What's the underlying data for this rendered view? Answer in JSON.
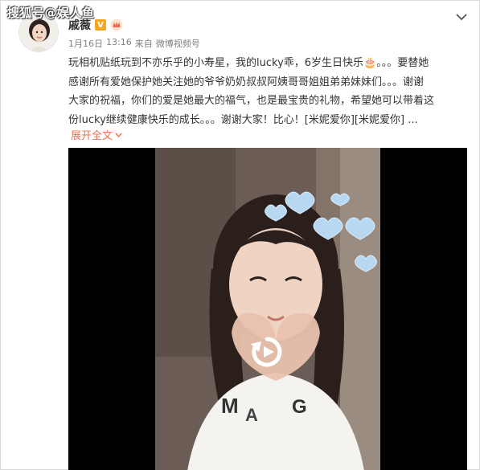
{
  "watermark": "搜狐号@娱人鱼",
  "user": {
    "name": "戚薇",
    "verified_badge": "V"
  },
  "meta": {
    "date": "1月16日",
    "time": "13:16",
    "source_prefix": "来自",
    "source": "微博视频号"
  },
  "post": {
    "line1_a": "玩相机贴纸玩到不亦乐乎的小寿星，我的lucky乖，6岁生日快乐",
    "cake": "🎂",
    "line1_b": "。。。要替她",
    "line2": "感谢所有爱她保护她关注她的爷爷奶奶叔叔阿姨哥哥姐姐弟弟妹妹们。。。谢谢",
    "line3": "大家的祝福，你们的爱是她最大的福气，也是最宝贵的礼物，希望她可以带着这",
    "line4_a": "份lucky继续健康快乐的成长。。。谢谢大家！比心！",
    "line4_link": "[米妮爱你][米妮爱你]",
    "line4_ellipsis": " ..."
  },
  "expand_label": "展开全文",
  "icons": {
    "chevron": "chevron-down-icon",
    "replay": "replay-icon",
    "verified": "verified-v-icon",
    "crown": "crown-badge-icon"
  },
  "colors": {
    "link": "#eb7350",
    "verified": "#f5a623",
    "meta": "#808080"
  }
}
